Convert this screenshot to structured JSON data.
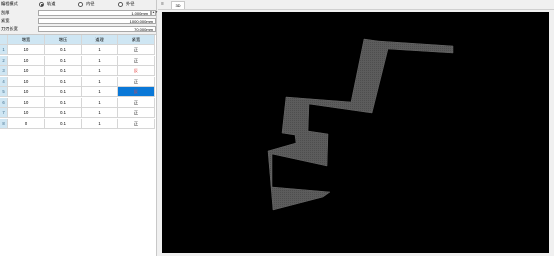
{
  "params": {
    "mode_label": "编程模式",
    "radio_options": [
      {
        "label": "轨道",
        "selected": true
      },
      {
        "label": "内径",
        "selected": false
      },
      {
        "label": "外径",
        "selected": false
      }
    ],
    "feed_label": "刮厚",
    "feed_value": "1.000mm",
    "scale_label": "紧宽",
    "scale_value": "1000.000mm",
    "width_label": "刀刃长宽",
    "width_value": "70.000mm"
  },
  "table": {
    "columns": [
      "增宽",
      "增压",
      "道理",
      "紧宽"
    ],
    "rows": [
      {
        "num": "1",
        "a": "10",
        "b": "0.1",
        "c": "1",
        "d": "正",
        "sel": false,
        "red": false
      },
      {
        "num": "2",
        "a": "10",
        "b": "0.1",
        "c": "1",
        "d": "正",
        "sel": false,
        "red": false
      },
      {
        "num": "3",
        "a": "10",
        "b": "0.1",
        "c": "1",
        "d": "反",
        "sel": false,
        "red": true
      },
      {
        "num": "4",
        "a": "10",
        "b": "0.1",
        "c": "1",
        "d": "正",
        "sel": false,
        "red": false
      },
      {
        "num": "5",
        "a": "10",
        "b": "0.1",
        "c": "1",
        "d": "反",
        "sel": true,
        "red": true
      },
      {
        "num": "6",
        "a": "10",
        "b": "0.1",
        "c": "1",
        "d": "正",
        "sel": false,
        "red": false
      },
      {
        "num": "7",
        "a": "10",
        "b": "0.1",
        "c": "1",
        "d": "正",
        "sel": false,
        "red": false
      },
      {
        "num": "8",
        "a": "0",
        "b": "0.1",
        "c": "1",
        "d": "正",
        "sel": false,
        "red": false
      }
    ]
  },
  "viewer": {
    "tab_label": "3D"
  },
  "colors": {
    "header_bg": "#cfe6f3",
    "selected_cell": "#0a78d7",
    "viewport_bg": "#000000",
    "model_fill": "#5a5a5a"
  }
}
